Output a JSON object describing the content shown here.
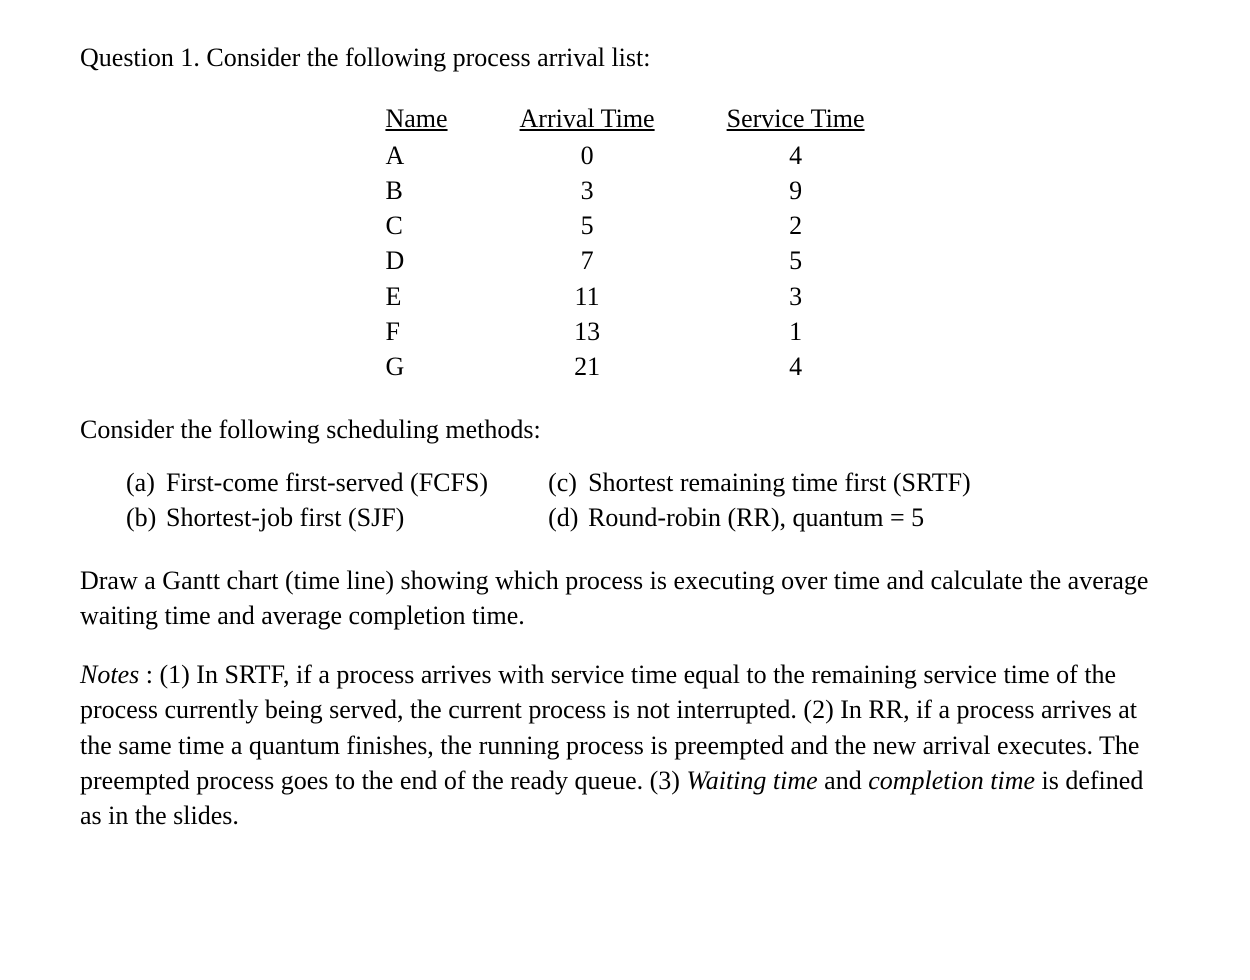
{
  "intro": "Question 1. Consider the following process arrival list:",
  "table": {
    "headers": {
      "name": "Name",
      "arrival": "Arrival Time",
      "service": "Service Time"
    },
    "rows": [
      {
        "name": "A",
        "arrival": "0",
        "service": "4"
      },
      {
        "name": "B",
        "arrival": "3",
        "service": "9"
      },
      {
        "name": "C",
        "arrival": "5",
        "service": "2"
      },
      {
        "name": "D",
        "arrival": "7",
        "service": "5"
      },
      {
        "name": "E",
        "arrival": "11",
        "service": "3"
      },
      {
        "name": "F",
        "arrival": "13",
        "service": "1"
      },
      {
        "name": "G",
        "arrival": "21",
        "service": "4"
      }
    ]
  },
  "subhead": "Consider the following scheduling methods:",
  "methods": {
    "a": {
      "label": "(a)",
      "text": "First-come first-served (FCFS)"
    },
    "b": {
      "label": "(b)",
      "text": "Shortest-job first (SJF)"
    },
    "c": {
      "label": "(c)",
      "text": "Shortest remaining time first (SRTF)"
    },
    "d": {
      "label": "(d)",
      "text": "Round-robin (RR), quantum = 5"
    }
  },
  "instructions": "Draw a Gantt chart (time line) showing which process is executing over time and calculate the average waiting time and average completion time.",
  "notes": {
    "prefix": "Notes",
    "sep": " :  ",
    "body1": "(1) In SRTF, if a process arrives with service time equal to the remaining service time of the process currently being served, the current process is not interrupted. (2) In RR, if a process arrives at the same time a quantum finishes, the running process is preempted and the new arrival executes.  The preempted process goes to the end of the ready queue.  (3) ",
    "wait": "Waiting time",
    "and": " and ",
    "comp": "completion time",
    "body2": " is defined as in the slides."
  }
}
